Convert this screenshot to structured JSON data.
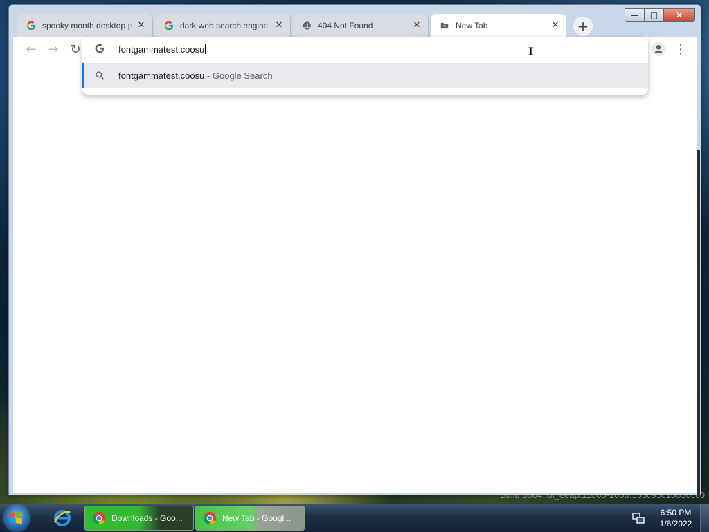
{
  "window": {
    "minimize_glyph": "—",
    "maximize_glyph": "□",
    "close_glyph": "✕"
  },
  "tabs": [
    {
      "title": "spooky month desktop p",
      "favicon": "google-g-icon",
      "active": false
    },
    {
      "title": "dark web search engine",
      "favicon": "google-g-icon",
      "active": false
    },
    {
      "title": "404 Not Found",
      "favicon": "globe-icon",
      "active": false
    },
    {
      "title": "New Tab",
      "favicon": "newtab-page-icon",
      "active": true
    }
  ],
  "tab_close_glyph": "✕",
  "new_tab_glyph": "+",
  "toolbar": {
    "back_glyph": "←",
    "forward_glyph": "→",
    "reload_glyph": "↻",
    "menu_glyph": "⋮"
  },
  "omnibox": {
    "input_value": "fontgammatest.coosu",
    "suggestion_text": "fontgammatest.coosu",
    "suggestion_suffix": " - Google Search",
    "accent_color": "#1a73e8"
  },
  "desktop": {
    "build_text": "Build 8004.fbl_eeap.11060-1000.555c95c18030cc0"
  },
  "taskbar": {
    "items": [
      {
        "label": "Downloads - Goo...",
        "icon": "chrome-icon"
      },
      {
        "label": "New Tab - Googl...",
        "icon": "chrome-icon"
      }
    ],
    "clock_time": "6:50 PM",
    "clock_date": "1/6/2022"
  }
}
